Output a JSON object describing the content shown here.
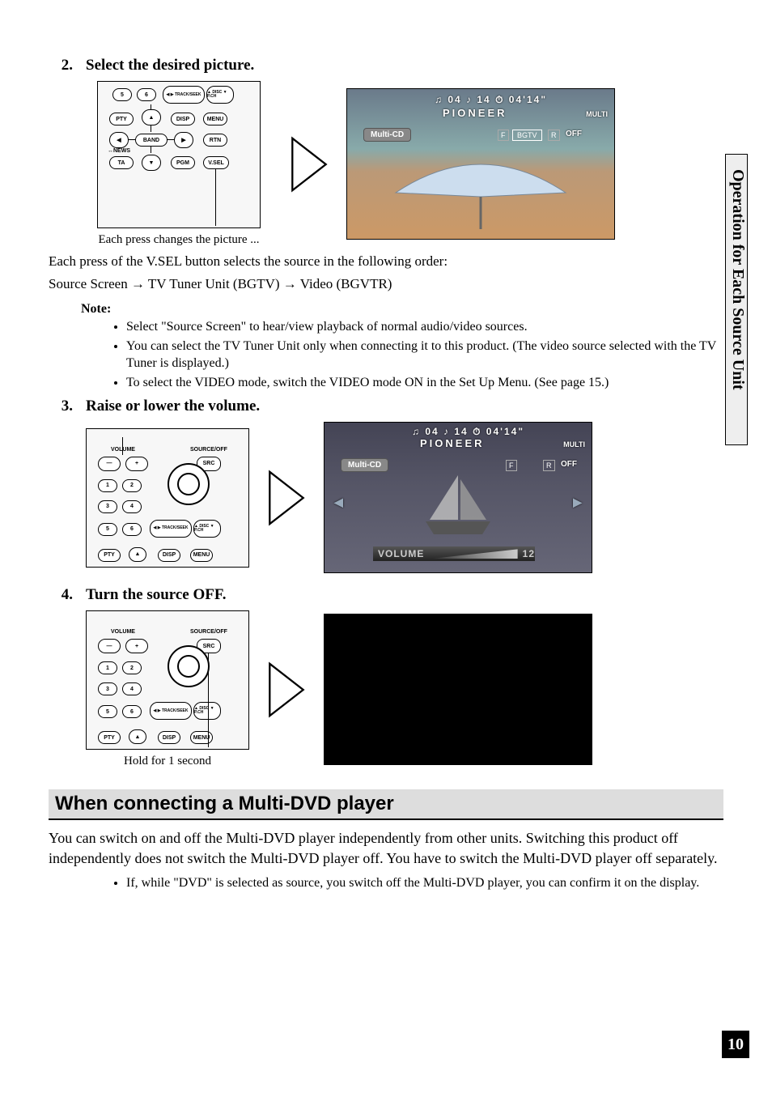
{
  "side_tab": "Operation for Each Source Unit",
  "page_number": "10",
  "step2": {
    "num": "2.",
    "title": "Select the desired picture.",
    "caption": "Each press changes the picture ...",
    "remote": {
      "btn_5": "5",
      "btn_6": "6",
      "btn_track": "◀ ▶\nTRACK/SEEK",
      "btn_disc": "▲ DISC\n▼ P.CH",
      "btn_pty": "PTY",
      "btn_up": "▲",
      "btn_disp": "DISP",
      "btn_menu": "MENU",
      "btn_left": "◀",
      "btn_band": "BAND",
      "btn_right": "▶",
      "btn_rtn": "RTN",
      "lbl_news": "↔NEWS",
      "btn_ta": "TA",
      "btn_down": "▼",
      "btn_pgm": "PGM",
      "btn_vsel": "V.SEL"
    },
    "screen": {
      "time_left": "04",
      "time_mid": "14",
      "time_right": "04'14\"",
      "brand": "PIONEER",
      "multi_label": "MULTI",
      "source_pill": "Multi-CD",
      "badge_f": "F",
      "badge_bgtv": "BGTV",
      "badge_r": "R",
      "badge_off": "OFF"
    },
    "followup1": "Each press of the V.SEL button selects the source in the following order:",
    "sequence": {
      "a": "Source Screen",
      "arr1": "→",
      "b": "TV Tuner Unit (BGTV)",
      "arr2": "→",
      "c": "Video (BGVTR)"
    },
    "note_label": "Note:",
    "notes": [
      "Select \"Source Screen\" to hear/view playback of normal audio/video sources.",
      "You can select the TV Tuner Unit only when connecting it to this product. (The video source selected with the TV Tuner is displayed.)",
      "To select the VIDEO mode, switch the VIDEO mode ON in the Set Up Menu. (See page 15.)"
    ]
  },
  "step3": {
    "num": "3.",
    "title": "Raise or lower the volume.",
    "remote": {
      "lbl_volume": "VOLUME",
      "lbl_srcoff": "SOURCE/OFF",
      "btn_minus": "—",
      "btn_plus": "+",
      "btn_src": "SRC",
      "btn_1": "1",
      "btn_2": "2",
      "btn_3": "3",
      "btn_4": "4",
      "btn_5": "5",
      "btn_6": "6",
      "btn_track": "◀ ▶\nTRACK/SEEK",
      "btn_disc": "▲ DISC\n▼ P.CH",
      "btn_pty": "PTY",
      "btn_up": "▲",
      "btn_disp": "DISP",
      "btn_menu": "MENU"
    },
    "screen": {
      "time_left": "04",
      "time_mid": "14",
      "time_right": "04'14\"",
      "brand": "PIONEER",
      "multi_label": "MULTI",
      "source_pill": "Multi-CD",
      "badge_f": "F",
      "badge_r": "R",
      "badge_off": "OFF",
      "nav_left": "◀",
      "nav_right": "▶",
      "volume_label": "VOLUME",
      "volume_value": "12"
    }
  },
  "step4": {
    "num": "4.",
    "title": "Turn the source OFF.",
    "caption": "Hold for 1 second",
    "remote": {
      "lbl_volume": "VOLUME",
      "lbl_srcoff": "SOURCE/OFF",
      "btn_minus": "—",
      "btn_plus": "+",
      "btn_src": "SRC",
      "btn_1": "1",
      "btn_2": "2",
      "btn_3": "3",
      "btn_4": "4",
      "btn_5": "5",
      "btn_6": "6",
      "btn_track": "◀ ▶\nTRACK/SEEK",
      "btn_disc": "▲ DISC\n▼ P.CH",
      "btn_pty": "PTY",
      "btn_up": "▲",
      "btn_disp": "DISP",
      "btn_menu": "MENU"
    }
  },
  "section": {
    "heading": "When connecting a Multi-DVD player",
    "para": "You can switch on and off the Multi-DVD player independently from other units. Switching this product off independently does not switch the Multi-DVD player off. You have to switch the Multi-DVD player off separately.",
    "bullet": "If, while \"DVD\" is selected as source, you switch off the Multi-DVD player, you can confirm it on the display."
  }
}
